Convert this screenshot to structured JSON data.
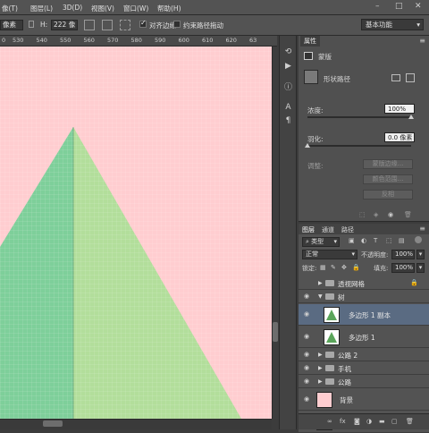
{
  "menubar": {
    "items": [
      {
        "label": "像(T)"
      },
      {
        "label": "图层(L)"
      },
      {
        "label": "3D(D)"
      },
      {
        "label": "视图(V)"
      },
      {
        "label": "窗口(W)"
      },
      {
        "label": "帮助(H)"
      }
    ],
    "window_controls": [
      "–",
      "□",
      "✕"
    ]
  },
  "options": {
    "w_value": "像素",
    "h_label": "H:",
    "h_value": "222 像",
    "align_edges_label": "对齐边缘",
    "align_edges_checked": true,
    "constrain_label": "约束路径拖动",
    "constrain_checked": false,
    "workspace": "基本功能"
  },
  "ruler": {
    "ticks": [
      "0",
      "530",
      "540",
      "550",
      "560",
      "570",
      "580",
      "590",
      "600",
      "610",
      "620",
      "63"
    ]
  },
  "canvas": {
    "background_color": "#ffcdd0",
    "triangle_left_color": "#7ecf9a",
    "triangle_right_color": "#b2de9b"
  },
  "properties": {
    "tab": "属性",
    "mask_label": "蒙版",
    "shape_label": "形状路径",
    "density_label": "浓度:",
    "density_value": "100%",
    "feather_label": "羽化:",
    "feather_value": "0.0 像素",
    "adjust_label": "调整:",
    "mask_edge_button": "蒙版边缘...",
    "color_range_button": "颜色范围...",
    "invert_button": "反相"
  },
  "layers": {
    "tabs": [
      "图层",
      "通道",
      "路径"
    ],
    "filter_kind": "类型",
    "blend_mode": "正常",
    "opacity_label": "不透明度:",
    "opacity_value": "100%",
    "lock_label": "锁定:",
    "fill_label": "填充:",
    "fill_value": "100%",
    "items": [
      {
        "name": "透视网格",
        "visible": false,
        "kind": "group",
        "locked": true
      },
      {
        "name": "树",
        "visible": true,
        "kind": "group-open"
      },
      {
        "name": "多边形 1 副本",
        "visible": true,
        "kind": "shape",
        "selected": true
      },
      {
        "name": "多边形 1",
        "visible": true,
        "kind": "shape"
      },
      {
        "name": "公路 2",
        "visible": true,
        "kind": "group"
      },
      {
        "name": "手机",
        "visible": true,
        "kind": "group"
      },
      {
        "name": "公路",
        "visible": true,
        "kind": "group"
      },
      {
        "name": "背景",
        "visible": true,
        "kind": "fill",
        "thumb_color": "#ffcdd0"
      },
      {
        "name": "背景",
        "visible": true,
        "kind": "background",
        "thumb_color": "#ffffff",
        "locked": true
      }
    ]
  }
}
